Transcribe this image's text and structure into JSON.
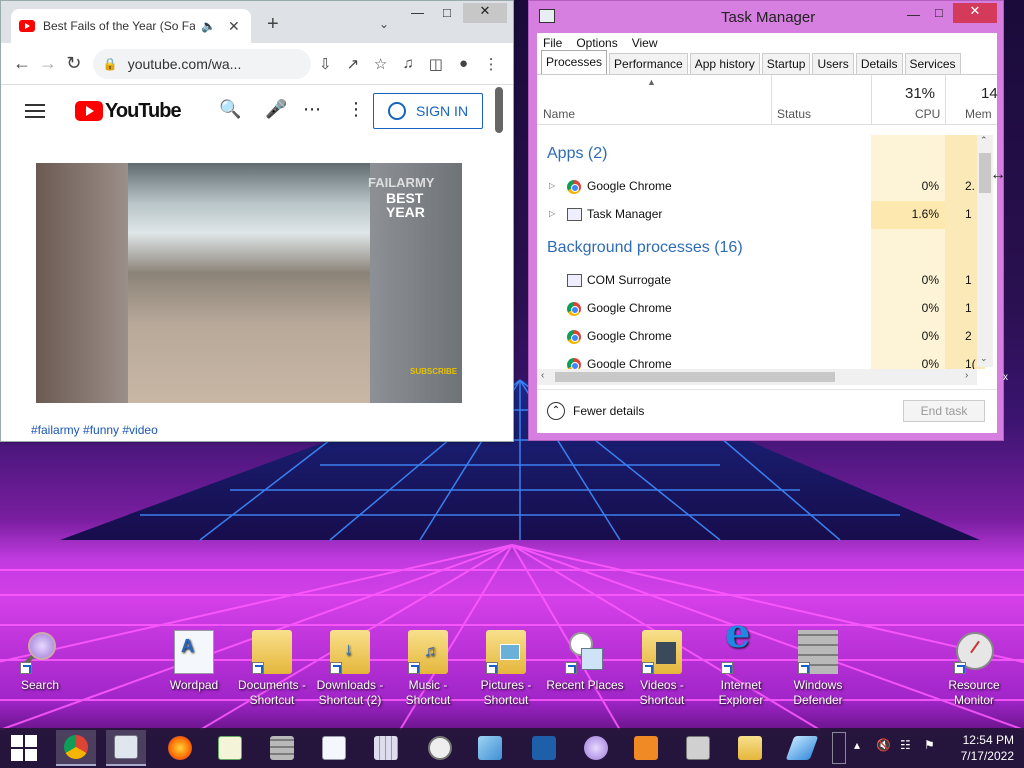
{
  "chrome": {
    "tab_title": "Best Fails of the Year (So Far",
    "tab_audio_icon": "speaker-icon",
    "address": "youtube.com/wa...",
    "yt_logo_text": "YouTube",
    "signin_label": "SIGN IN",
    "video_overlay_brand": "FAILARMY",
    "video_overlay_title": "BEST YEAR",
    "video_overlay_subscribe": "SUBSCRIBE",
    "hashtags": "#failarmy #funny #video"
  },
  "taskmgr": {
    "title": "Task Manager",
    "menu": [
      "File",
      "Options",
      "View"
    ],
    "tabs": [
      "Processes",
      "Performance",
      "App history",
      "Startup",
      "Users",
      "Details",
      "Services"
    ],
    "active_tab": "Processes",
    "columns": {
      "name": "Name",
      "status": "Status",
      "cpu": "CPU",
      "memory": "Mem"
    },
    "cpu_total": "31%",
    "mem_total": "14",
    "apps_header": "Apps (2)",
    "apps": [
      {
        "name": "Google Chrome",
        "cpu": "0%",
        "mem": "2."
      },
      {
        "name": "Task Manager",
        "cpu": "1.6%",
        "mem": "1"
      }
    ],
    "bg_header": "Background processes (16)",
    "background": [
      {
        "name": "COM Surrogate",
        "cpu": "0%",
        "mem": "1"
      },
      {
        "name": "Google Chrome",
        "cpu": "0%",
        "mem": "1"
      },
      {
        "name": "Google Chrome",
        "cpu": "0%",
        "mem": "2"
      },
      {
        "name": "Google Chrome",
        "cpu": "0%",
        "mem": "1("
      }
    ],
    "fewer_details": "Fewer details",
    "end_task": "End task"
  },
  "desktop_icons": [
    {
      "label": "Search",
      "icon": "search-magnifier-icon"
    },
    {
      "label": "Wordpad",
      "icon": "wordpad-icon"
    },
    {
      "label": "Documents - Shortcut",
      "icon": "documents-folder-icon"
    },
    {
      "label": "Downloads - Shortcut (2)",
      "icon": "downloads-folder-icon"
    },
    {
      "label": "Music - Shortcut",
      "icon": "music-folder-icon"
    },
    {
      "label": "Pictures - Shortcut",
      "icon": "pictures-folder-icon"
    },
    {
      "label": "Recent Places",
      "icon": "recent-places-icon"
    },
    {
      "label": "Videos - Shortcut",
      "icon": "videos-folder-icon"
    },
    {
      "label": "Internet Explorer",
      "icon": "internet-explorer-icon"
    },
    {
      "label": "Windows Defender",
      "icon": "windows-defender-icon"
    },
    {
      "label": "Resource Monitor",
      "icon": "resource-monitor-icon"
    }
  ],
  "taskbar": {
    "apps": [
      "start",
      "chrome",
      "task-manager",
      "firefox",
      "notepad-plus",
      "defender",
      "wordpad",
      "calculator",
      "clock",
      "notepad",
      "powershell",
      "search",
      "media-player",
      "fax-scan",
      "folder",
      "send"
    ],
    "time": "12:54 PM",
    "date": "7/17/2022"
  },
  "colors": {
    "tm_frame": "#d67fe0",
    "tm_close": "#d43a5a",
    "yt_red": "#ff0000",
    "link_blue": "#1a56b5",
    "section_blue": "#2e6bb5"
  }
}
